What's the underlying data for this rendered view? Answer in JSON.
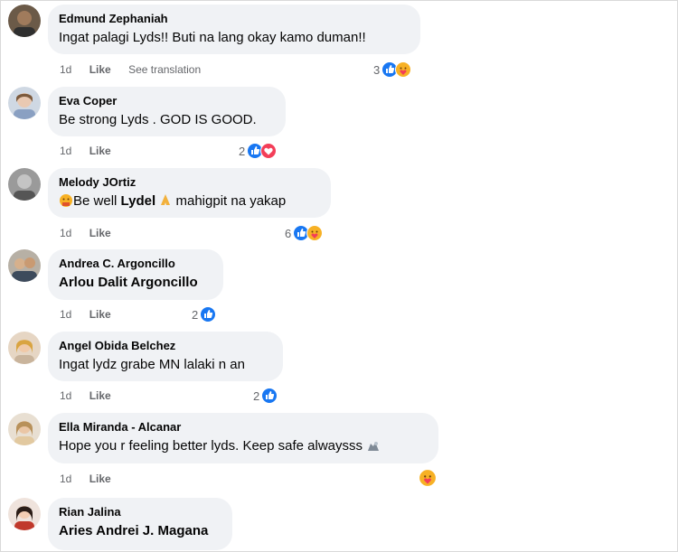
{
  "comments": [
    {
      "author": "Edmund Zephaniah",
      "text": "Ingat palagi Lyds!! Buti na lang okay kamo duman!!",
      "time": "1d",
      "like": "Like",
      "translate": "See translation",
      "reaction_count": "3",
      "reactions": [
        "like-icon",
        "care-icon"
      ]
    },
    {
      "author": "Eva Coper",
      "text": "Be strong Lyds . GOD IS GOOD.",
      "time": "1d",
      "like": "Like",
      "reaction_count": "2",
      "reactions": [
        "like-icon",
        "love-icon"
      ]
    },
    {
      "author": "Melody JOrtiz",
      "text_before": "Be well ",
      "mention": "Lydel",
      "text_after": " mahigpit na yakap",
      "time": "1d",
      "like": "Like",
      "reaction_count": "6",
      "reactions": [
        "like-icon",
        "care-icon"
      ]
    },
    {
      "author": "Andrea C. Argoncillo",
      "mention": "Arlou Dalit Argoncillo",
      "time": "1d",
      "like": "Like",
      "reaction_count": "2",
      "reactions": [
        "like-icon"
      ]
    },
    {
      "author": "Angel Obida Belchez",
      "text": "Ingat lydz grabe MN lalaki n an",
      "time": "1d",
      "like": "Like",
      "reaction_count": "2",
      "reactions": [
        "like-icon"
      ]
    },
    {
      "author": "Ella Miranda - Alcanar",
      "text": "Hope you r feeling better lyds. Keep safe alwaysss",
      "time": "1d",
      "like": "Like",
      "reactions": [
        "care-icon"
      ]
    },
    {
      "author": "Rian Jalina",
      "mention": "Aries Andrei J. Magana"
    }
  ],
  "colors": {
    "bubble": "#f0f2f5",
    "meta": "#65676b",
    "like_blue": "#1877f2",
    "love_red": "#f33e58",
    "care_yellow": "#f7b125"
  }
}
